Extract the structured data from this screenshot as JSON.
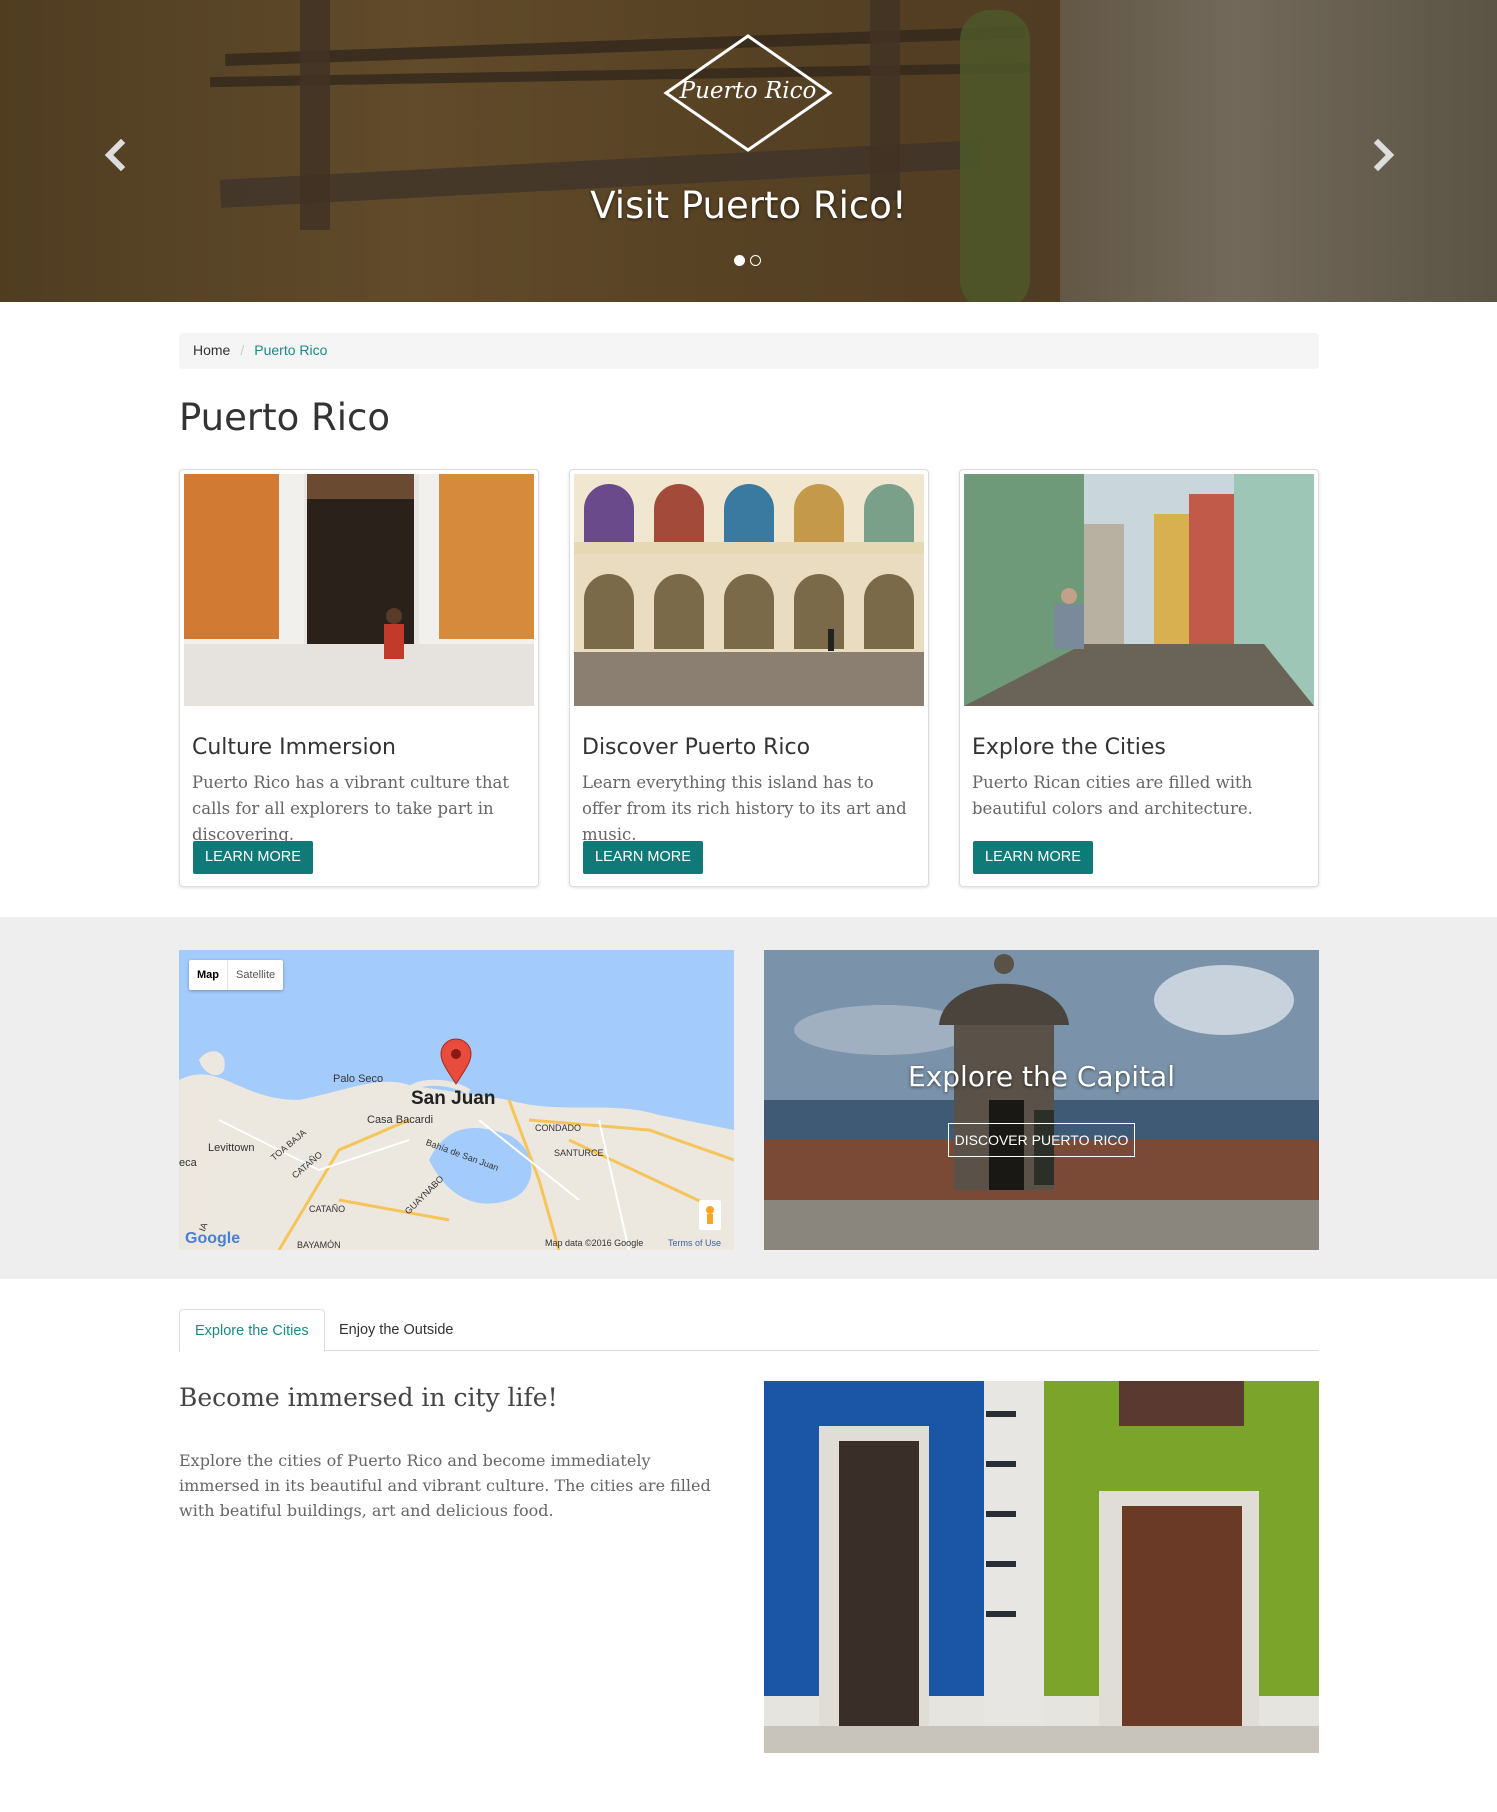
{
  "hero": {
    "logo_text": "Puerto Rico",
    "caption": "Visit Puerto Rico!",
    "slides": [
      {
        "active": true
      },
      {
        "active": false
      }
    ]
  },
  "breadcrumb": {
    "home": "Home",
    "current": "Puerto Rico"
  },
  "page_title": "Puerto Rico",
  "cards": [
    {
      "title": "Culture Immersion",
      "text": "Puerto Rico has a vibrant culture that calls for all explorers to take part in discovering.",
      "button": "LEARN MORE"
    },
    {
      "title": "Discover Puerto Rico",
      "text": "Learn everything this island has to offer from its rich history to its art and music.",
      "button": "LEARN MORE"
    },
    {
      "title": "Explore the Cities",
      "text": "Puerto Rican cities are filled with beautiful colors and architecture.",
      "button": "LEARN MORE"
    }
  ],
  "map": {
    "toggle_map": "Map",
    "toggle_satellite": "Satellite",
    "labels": {
      "palo_seco": "Palo Seco",
      "san_juan": "San Juan",
      "casa_bacardi": "Casa Bacardi",
      "condado": "CONDADO",
      "santurce": "SANTURCE",
      "bahia": "Bahía de San Juan",
      "levittown": "Levittown",
      "toa_baja": "TOA BAJA",
      "catano": "CATAÑO",
      "guaynabo": "GUAYNABO",
      "bayamon": "BAYAMÓN",
      "eca": "eca",
      "ia": "IA"
    },
    "google": "Google",
    "attribution": "Map data ©2016 Google",
    "terms": "Terms of Use"
  },
  "capital": {
    "title": "Explore the Capital",
    "button": "DISCOVER PUERTO RICO"
  },
  "tabs": [
    {
      "label": "Explore the Cities",
      "active": true
    },
    {
      "label": "Enjoy the Outside",
      "active": false
    }
  ],
  "tab_content": {
    "title": "Become immersed in city life!",
    "body": "Explore the cities of Puerto Rico and become immediately immersed in its beautiful and vibrant culture. The cities are filled with beatiful buildings, art and delicious food."
  },
  "colors": {
    "accent": "#0f7a78",
    "link": "#1a8a86",
    "band": "#eeeeee"
  }
}
